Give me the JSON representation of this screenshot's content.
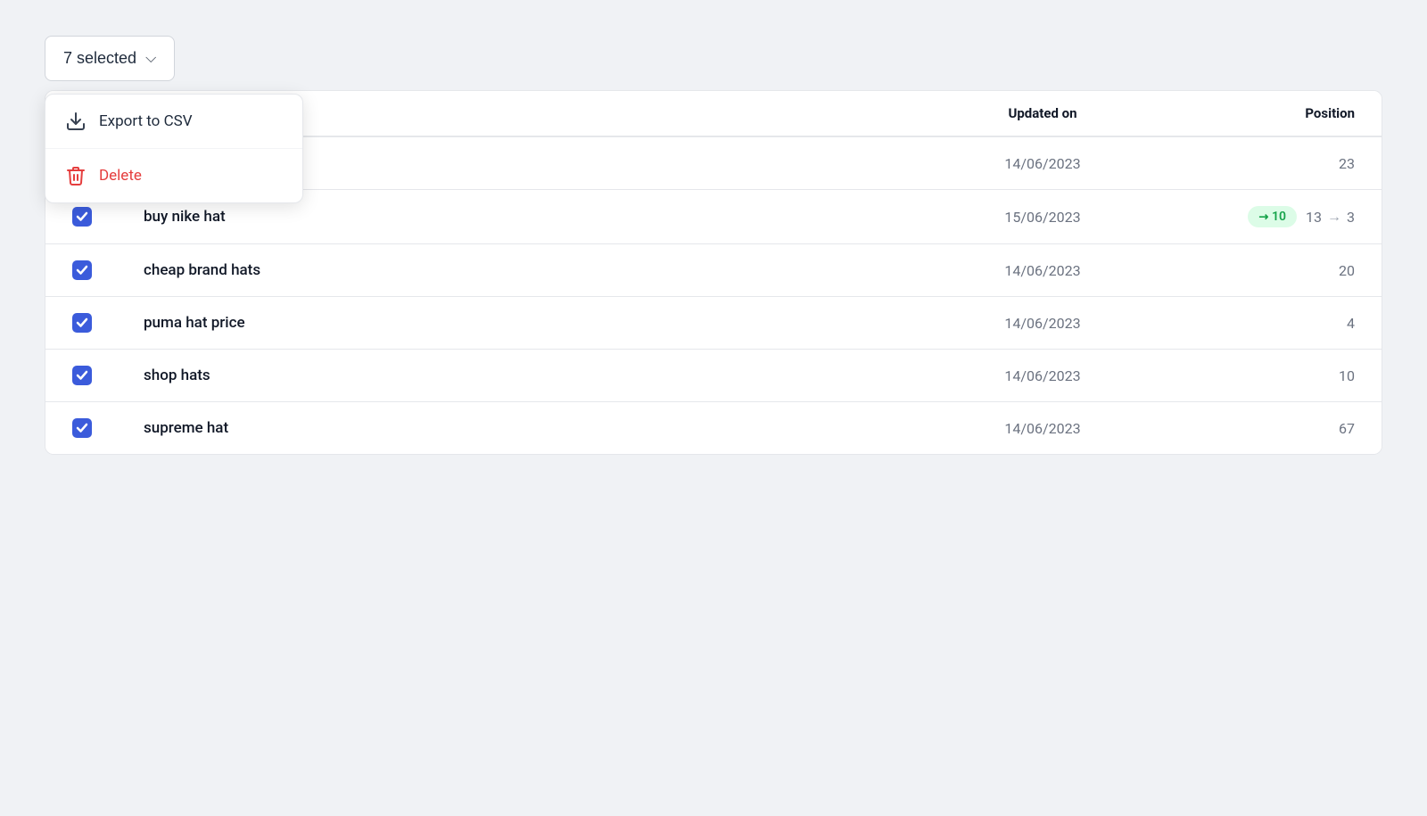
{
  "selectedButton": {
    "label": "7 selected",
    "count": 7
  },
  "dropdown": {
    "items": [
      {
        "id": "export",
        "label": "Export to CSV",
        "iconType": "download",
        "variant": "default"
      },
      {
        "id": "delete",
        "label": "Delete",
        "iconType": "trash",
        "variant": "danger"
      }
    ]
  },
  "table": {
    "columns": [
      {
        "id": "checkbox",
        "label": ""
      },
      {
        "id": "keyword",
        "label": ""
      },
      {
        "id": "updated_on",
        "label": "Updated on"
      },
      {
        "id": "position",
        "label": "Position"
      }
    ],
    "rows": [
      {
        "id": "row-1",
        "checked": true,
        "keyword": "",
        "date": "14/06/2023",
        "position": "23",
        "hasChange": false,
        "partialTop": true
      },
      {
        "id": "row-2",
        "checked": true,
        "keyword": "buy nike hat",
        "date": "15/06/2023",
        "position": "3",
        "positionFrom": "13",
        "positionTo": "3",
        "hasChange": true,
        "badge": "10"
      },
      {
        "id": "row-3",
        "checked": true,
        "keyword": "cheap brand hats",
        "date": "14/06/2023",
        "position": "20",
        "hasChange": false
      },
      {
        "id": "row-4",
        "checked": true,
        "keyword": "puma hat price",
        "date": "14/06/2023",
        "position": "4",
        "hasChange": false
      },
      {
        "id": "row-5",
        "checked": true,
        "keyword": "shop hats",
        "date": "14/06/2023",
        "position": "10",
        "hasChange": false
      },
      {
        "id": "row-6",
        "checked": true,
        "keyword": "supreme hat",
        "date": "14/06/2023",
        "position": "67",
        "hasChange": false,
        "partialBottom": true
      }
    ]
  },
  "colors": {
    "checkboxBlue": "#3b5bdb",
    "badgeGreen": "#dcfce7",
    "badgeGreenText": "#16a34a",
    "deleteRed": "#e53e3e"
  }
}
